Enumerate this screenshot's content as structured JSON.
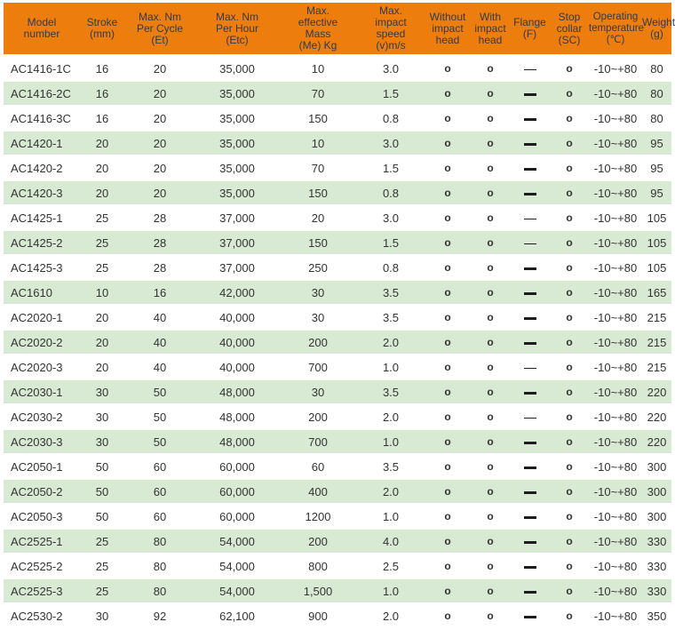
{
  "table": {
    "colors": {
      "header_bg": "#ED7D0C",
      "header_text": "#2F3B52",
      "row_alt_bg": "#D8EAD3",
      "row_bg": "#FFFFFF",
      "body_text": "#333333"
    },
    "columns": [
      {
        "id": "model",
        "label": "Model\nnumber",
        "width": 86
      },
      {
        "id": "stroke",
        "label": "Stroke\n(mm)",
        "width": 50
      },
      {
        "id": "et",
        "label": "Max. Nm\nPer Cycle\n(Et)",
        "width": 80
      },
      {
        "id": "etc",
        "label": "Max. Nm\nPer Hour\n(Etc)",
        "width": 94
      },
      {
        "id": "mass",
        "label": "Max.\neffective\nMass\n(Me) Kg",
        "width": 88
      },
      {
        "id": "speed",
        "label": "Max.\nimpact\nspeed\n(v)m/s",
        "width": 76
      },
      {
        "id": "without",
        "label": "Without\nimpact\nhead",
        "width": 52
      },
      {
        "id": "with",
        "label": "With\nimpact\nhead",
        "width": 44
      },
      {
        "id": "flange",
        "label": "Flange\n(F)",
        "width": 45
      },
      {
        "id": "stop",
        "label": "Stop\ncollar\n(SC)",
        "width": 44
      },
      {
        "id": "temp",
        "label": "Operating\ntemperature\n(℃)",
        "width": 60
      },
      {
        "id": "weight",
        "label": "Weight\n(g)",
        "width": 33
      }
    ],
    "rows": [
      {
        "model": "AC1416-1C",
        "stroke": "16",
        "et": "20",
        "etc": "35,000",
        "mass": "10",
        "speed": "3.0",
        "without": "o",
        "with": "o",
        "flange": "—",
        "flange_style": "thin",
        "stop": "o",
        "temp": "-10~+80",
        "weight": "80"
      },
      {
        "model": "AC1416-2C",
        "stroke": "16",
        "et": "20",
        "etc": "35,000",
        "mass": "70",
        "speed": "1.5",
        "without": "o",
        "with": "o",
        "flange": "—",
        "flange_style": "bold",
        "stop": "o",
        "temp": "-10~+80",
        "weight": "80"
      },
      {
        "model": "AC1416-3C",
        "stroke": "16",
        "et": "20",
        "etc": "35,000",
        "mass": "150",
        "speed": "0.8",
        "without": "o",
        "with": "o",
        "flange": "—",
        "flange_style": "bold",
        "stop": "o",
        "temp": "-10~+80",
        "weight": "80"
      },
      {
        "model": "AC1420-1",
        "stroke": "20",
        "et": "20",
        "etc": "35,000",
        "mass": "10",
        "speed": "3.0",
        "without": "o",
        "with": "o",
        "flange": "—",
        "flange_style": "bold",
        "stop": "o",
        "temp": "-10~+80",
        "weight": "95"
      },
      {
        "model": "AC1420-2",
        "stroke": "20",
        "et": "20",
        "etc": "35,000",
        "mass": "70",
        "speed": "1.5",
        "without": "o",
        "with": "o",
        "flange": "—",
        "flange_style": "bold",
        "stop": "o",
        "temp": "-10~+80",
        "weight": "95"
      },
      {
        "model": "AC1420-3",
        "stroke": "20",
        "et": "20",
        "etc": "35,000",
        "mass": "150",
        "speed": "0.8",
        "without": "o",
        "with": "o",
        "flange": "—",
        "flange_style": "bold",
        "stop": "o",
        "temp": "-10~+80",
        "weight": "95"
      },
      {
        "model": "AC1425-1",
        "stroke": "25",
        "et": "28",
        "etc": "37,000",
        "mass": "20",
        "speed": "3.0",
        "without": "o",
        "with": "o",
        "flange": "—",
        "flange_style": "thin",
        "stop": "o",
        "temp": "-10~+80",
        "weight": "105"
      },
      {
        "model": "AC1425-2",
        "stroke": "25",
        "et": "28",
        "etc": "37,000",
        "mass": "150",
        "speed": "1.5",
        "without": "o",
        "with": "o",
        "flange": "—",
        "flange_style": "thin",
        "stop": "o",
        "temp": "-10~+80",
        "weight": "105"
      },
      {
        "model": "AC1425-3",
        "stroke": "25",
        "et": "28",
        "etc": "37,000",
        "mass": "250",
        "speed": "0.8",
        "without": "o",
        "with": "o",
        "flange": "—",
        "flange_style": "bold",
        "stop": "o",
        "temp": "-10~+80",
        "weight": "105"
      },
      {
        "model": "AC1610",
        "stroke": "10",
        "et": "16",
        "etc": "42,000",
        "mass": "30",
        "speed": "3.5",
        "without": "o",
        "with": "o",
        "flange": "—",
        "flange_style": "bold",
        "stop": "o",
        "temp": "-10~+80",
        "weight": "165"
      },
      {
        "model": "AC2020-1",
        "stroke": "20",
        "et": "40",
        "etc": "40,000",
        "mass": "30",
        "speed": "3.5",
        "without": "o",
        "with": "o",
        "flange": "—",
        "flange_style": "bold",
        "stop": "o",
        "temp": "-10~+80",
        "weight": "215"
      },
      {
        "model": "AC2020-2",
        "stroke": "20",
        "et": "40",
        "etc": "40,000",
        "mass": "200",
        "speed": "2.0",
        "without": "o",
        "with": "o",
        "flange": "—",
        "flange_style": "bold",
        "stop": "o",
        "temp": "-10~+80",
        "weight": "215"
      },
      {
        "model": "AC2020-3",
        "stroke": "20",
        "et": "40",
        "etc": "40,000",
        "mass": "700",
        "speed": "1.0",
        "without": "o",
        "with": "o",
        "flange": "—",
        "flange_style": "thin",
        "stop": "o",
        "temp": "-10~+80",
        "weight": "215"
      },
      {
        "model": "AC2030-1",
        "stroke": "30",
        "et": "50",
        "etc": "48,000",
        "mass": "30",
        "speed": "3.5",
        "without": "o",
        "with": "o",
        "flange": "—",
        "flange_style": "bold",
        "stop": "o",
        "temp": "-10~+80",
        "weight": "220"
      },
      {
        "model": "AC2030-2",
        "stroke": "30",
        "et": "50",
        "etc": "48,000",
        "mass": "200",
        "speed": "2.0",
        "without": "o",
        "with": "o",
        "flange": "—",
        "flange_style": "thin",
        "stop": "o",
        "temp": "-10~+80",
        "weight": "220"
      },
      {
        "model": "AC2030-3",
        "stroke": "30",
        "et": "50",
        "etc": "48,000",
        "mass": "700",
        "speed": "1.0",
        "without": "o",
        "with": "o",
        "flange": "—",
        "flange_style": "bold",
        "stop": "o",
        "temp": "-10~+80",
        "weight": "220"
      },
      {
        "model": "AC2050-1",
        "stroke": "50",
        "et": "60",
        "etc": "60,000",
        "mass": "60",
        "speed": "3.5",
        "without": "o",
        "with": "o",
        "flange": "—",
        "flange_style": "bold",
        "stop": "o",
        "temp": "-10~+80",
        "weight": "300"
      },
      {
        "model": "AC2050-2",
        "stroke": "50",
        "et": "60",
        "etc": "60,000",
        "mass": "400",
        "speed": "2.0",
        "without": "o",
        "with": "o",
        "flange": "—",
        "flange_style": "bold",
        "stop": "o",
        "temp": "-10~+80",
        "weight": "300"
      },
      {
        "model": "AC2050-3",
        "stroke": "50",
        "et": "60",
        "etc": "60,000",
        "mass": "1200",
        "speed": "1.0",
        "without": "o",
        "with": "o",
        "flange": "—",
        "flange_style": "bold",
        "stop": "o",
        "temp": "-10~+80",
        "weight": "300"
      },
      {
        "model": "AC2525-1",
        "stroke": "25",
        "et": "80",
        "etc": "54,000",
        "mass": "200",
        "speed": "4.0",
        "without": "o",
        "with": "o",
        "flange": "—",
        "flange_style": "bold",
        "stop": "o",
        "temp": "-10~+80",
        "weight": "330"
      },
      {
        "model": "AC2525-2",
        "stroke": "25",
        "et": "80",
        "etc": "54,000",
        "mass": "800",
        "speed": "2.5",
        "without": "o",
        "with": "o",
        "flange": "—",
        "flange_style": "bold",
        "stop": "o",
        "temp": "-10~+80",
        "weight": "330"
      },
      {
        "model": "AC2525-3",
        "stroke": "25",
        "et": "80",
        "etc": "54,000",
        "mass": "1,500",
        "speed": "1.0",
        "without": "o",
        "with": "o",
        "flange": "—",
        "flange_style": "bold",
        "stop": "o",
        "temp": "-10~+80",
        "weight": "330"
      },
      {
        "model": "AC2530-2",
        "stroke": "30",
        "et": "92",
        "etc": "62,100",
        "mass": "900",
        "speed": "2.0",
        "without": "o",
        "with": "o",
        "flange": "—",
        "flange_style": "bold",
        "stop": "o",
        "temp": "-10~+80",
        "weight": "350"
      }
    ]
  }
}
